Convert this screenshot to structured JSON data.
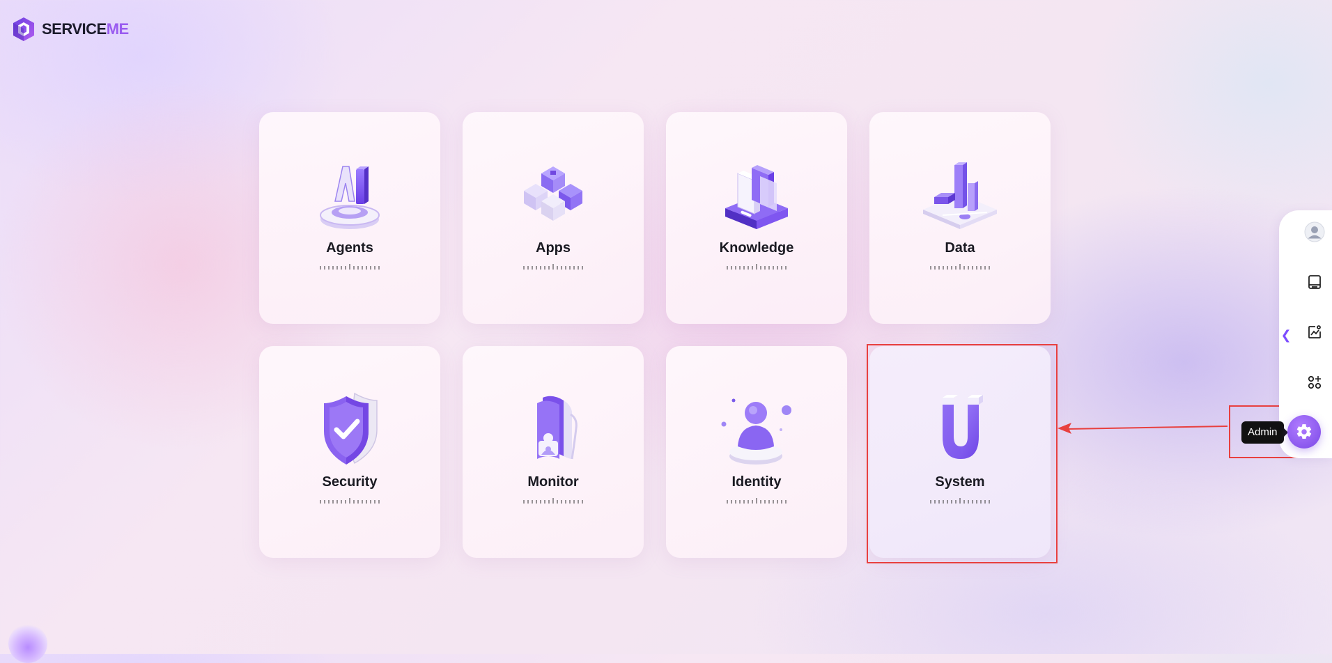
{
  "brand": {
    "name_primary": "SERVICE",
    "name_accent": "ME",
    "accent_color": "#9a5cf0"
  },
  "cards": [
    {
      "id": "agents",
      "label": "Agents",
      "icon": "ai-agent-icon"
    },
    {
      "id": "apps",
      "label": "Apps",
      "icon": "apps-cubes-icon"
    },
    {
      "id": "knowledge",
      "label": "Knowledge",
      "icon": "knowledge-books-icon"
    },
    {
      "id": "data",
      "label": "Data",
      "icon": "data-chart-icon"
    },
    {
      "id": "security",
      "label": "Security",
      "icon": "security-shield-icon"
    },
    {
      "id": "monitor",
      "label": "Monitor",
      "icon": "monitor-badge-icon"
    },
    {
      "id": "identity",
      "label": "Identity",
      "icon": "identity-person-icon"
    },
    {
      "id": "system",
      "label": "System",
      "icon": "system-magnet-icon"
    }
  ],
  "sidebar": {
    "items": [
      {
        "icon": "user-avatar-icon"
      },
      {
        "icon": "book-icon"
      },
      {
        "icon": "analytics-icon"
      },
      {
        "icon": "apps-grid-icon"
      }
    ],
    "collapse_glyph": "❮",
    "admin": {
      "icon": "gear-icon",
      "tooltip": "Admin"
    }
  },
  "colors": {
    "primary": "#7b49e6",
    "highlight": "#e8403f"
  }
}
